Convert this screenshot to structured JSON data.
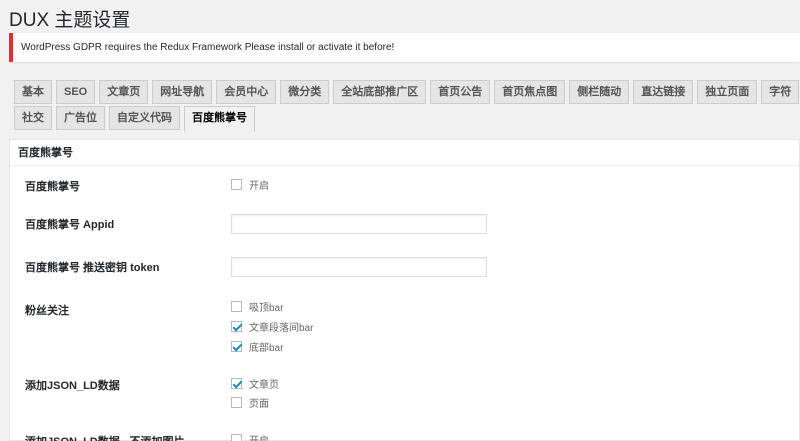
{
  "page": {
    "title": "DUX 主题设置"
  },
  "notice": {
    "text": "WordPress GDPR requires the Redux Framework Please install or activate it before!"
  },
  "tabs": {
    "row1": [
      "基本",
      "SEO",
      "文章页",
      "网址导航",
      "会员中心",
      "微分类",
      "全站底部推广区",
      "首页公告",
      "首页焦点图",
      "侧栏随动",
      "直达链接",
      "独立页面",
      "字符"
    ],
    "row2": [
      "社交",
      "广告位",
      "自定义代码",
      "百度熊掌号"
    ],
    "active": "百度熊掌号"
  },
  "panel": {
    "header": "百度熊掌号",
    "fields": {
      "xzh_enable": {
        "label": "百度熊掌号",
        "option": "开启",
        "checked": false
      },
      "appid": {
        "label": "百度熊掌号 Appid",
        "value": ""
      },
      "token": {
        "label": "百度熊掌号 推送密钥 token",
        "value": ""
      },
      "fans": {
        "label": "粉丝关注",
        "options": [
          {
            "label": "吸顶bar",
            "checked": false
          },
          {
            "label": "文章段落间bar",
            "checked": true
          },
          {
            "label": "底部bar",
            "checked": true
          }
        ]
      },
      "jsonld": {
        "label": "添加JSON_LD数据",
        "options": [
          {
            "label": "文章页",
            "checked": true
          },
          {
            "label": "页面",
            "checked": false
          }
        ]
      },
      "jsonld_noimg": {
        "label": "添加JSON_LD数据 - 不添加图片",
        "option": "开启",
        "checked": false
      }
    }
  }
}
